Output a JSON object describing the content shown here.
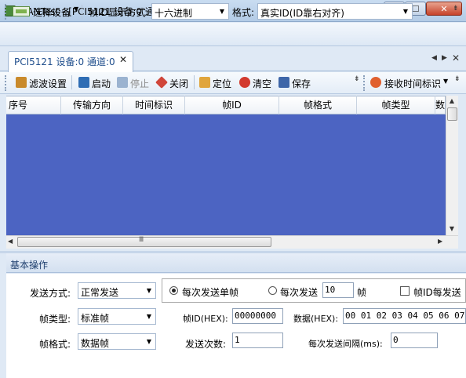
{
  "window": {
    "title": "CANTest  - [PCI5121 设备:0 通道:0]",
    "controls": {
      "minimize": "▁",
      "maximize": "☐",
      "close": "✕"
    }
  },
  "toolbar1": {
    "select_device": "选择设备",
    "frame_id_display_label": "帧ID显示方式:",
    "frame_id_display_value": "十六进制",
    "format_label": "格式:",
    "format_value": "真实ID(ID靠右对齐)"
  },
  "tab": {
    "label": "PCI5121 设备:0 通道:0"
  },
  "toolbar2": {
    "filter": "滤波设置",
    "start": "启动",
    "stop": "停止",
    "close": "关闭",
    "locate": "定位",
    "clear": "清空",
    "save": "保存",
    "receive_time": "接收时间标识"
  },
  "grid": {
    "columns": [
      "序号",
      "传输方向",
      "时间标识",
      "帧ID",
      "帧格式",
      "帧类型",
      "数"
    ],
    "rows": []
  },
  "panel": {
    "title": "基本操作",
    "send_mode_label": "发送方式:",
    "send_mode_value": "正常发送",
    "frame_type_label": "帧类型:",
    "frame_type_value": "标准帧",
    "frame_format_label": "帧格式:",
    "frame_format_value": "数据帧",
    "radio_single": "每次发送单帧",
    "radio_multi": "每次发送",
    "multi_count": "10",
    "multi_unit": "帧",
    "increment_label": "帧ID每发送",
    "frame_id_hex_label": "帧ID(HEX):",
    "frame_id_value": "00000000",
    "data_hex_label": "数据(HEX):",
    "data_value": "00 01 02 03 04 05 06 07",
    "send_count_label": "发送次数:",
    "send_count_value": "1",
    "interval_label": "每次发送间隔(ms):",
    "interval_value": "0"
  },
  "colors": {
    "grid_background": "#4c64c2",
    "title_bar": "#c9dcf1"
  }
}
